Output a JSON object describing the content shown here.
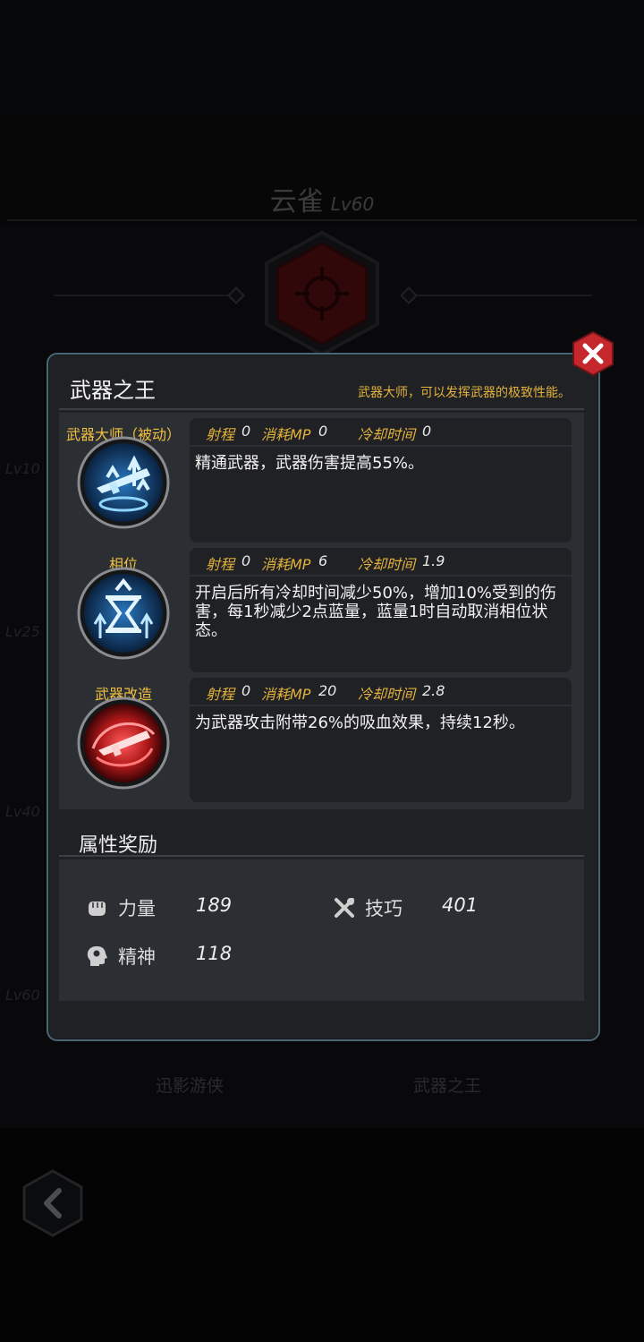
{
  "background": {
    "hero": {
      "name": "云雀",
      "level": "Lv60"
    },
    "level_markers": [
      "Lv10",
      "Lv25",
      "Lv40",
      "Lv60"
    ],
    "bottom_nodes": [
      "迅影游侠",
      "武器之王"
    ]
  },
  "panel": {
    "title": "武器之王",
    "subtitle": "武器大师，可以发挥武器的极致性能。",
    "skills": [
      {
        "name": "武器大师（被动）",
        "stats": {
          "range_label": "射程",
          "range": "0",
          "mp_label": "消耗MP",
          "mp": "0",
          "cd_label": "冷却时间",
          "cd": "0"
        },
        "description": "精通武器，武器伤害提高55%。",
        "icon": "rifle-upgrade-icon"
      },
      {
        "name": "相位",
        "stats": {
          "range_label": "射程",
          "range": "0",
          "mp_label": "消耗MP",
          "mp": "6",
          "cd_label": "冷却时间",
          "cd": "1.9"
        },
        "description": "开启后所有冷却时间减少50%，增加10%受到的伤害，每1秒减少2点蓝量，蓝量1时自动取消相位状态。",
        "icon": "hourglass-icon"
      },
      {
        "name": "武器改造",
        "stats": {
          "range_label": "射程",
          "range": "0",
          "mp_label": "消耗MP",
          "mp": "20",
          "cd_label": "冷却时间",
          "cd": "2.8"
        },
        "description": "为武器攻击附带26%的吸血效果，持续12秒。",
        "icon": "rifle-vortex-icon"
      }
    ],
    "attributes": {
      "title": "属性奖励",
      "items": [
        {
          "label": "力量",
          "value": "189",
          "icon": "fist-icon"
        },
        {
          "label": "技巧",
          "value": "401",
          "icon": "tools-icon"
        },
        {
          "label": "精神",
          "value": "118",
          "icon": "head-mind-icon"
        }
      ]
    }
  },
  "colors": {
    "accent_gold": "#e3b23c",
    "panel_border": "#4b6573",
    "close_red": "#c4272c"
  }
}
